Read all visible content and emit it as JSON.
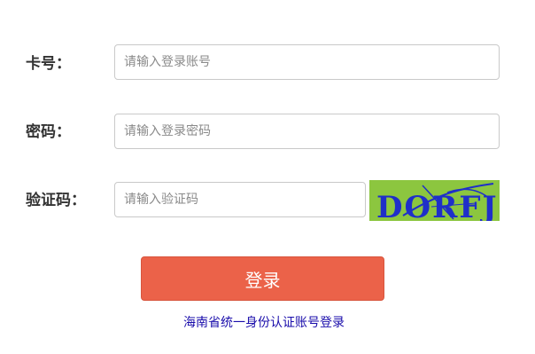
{
  "form": {
    "card_label": "卡号：",
    "card_placeholder": "请输入登录账号",
    "password_label": "密码：",
    "password_placeholder": "请输入登录密码",
    "code_label": "验证码：",
    "code_placeholder": "请输入验证码",
    "captcha_text": "DORFJ",
    "captcha_bg": "#8cc63f",
    "captcha_fg": "#1f2fc9"
  },
  "actions": {
    "login_label": "登录",
    "login_color": "#eb6249",
    "alt_login_link": "海南省统一身份认证账号登录",
    "link_color": "#1a0dab"
  }
}
